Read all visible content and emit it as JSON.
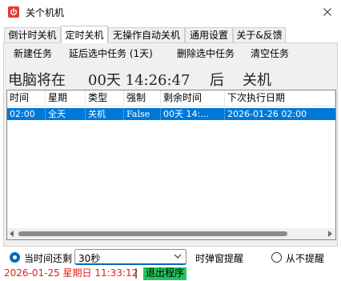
{
  "window": {
    "title": "关个机机",
    "icon": "power-red-square-icon",
    "close_icon": "close-icon"
  },
  "tabs": [
    {
      "label": "倒计时关机",
      "active": false
    },
    {
      "label": "定时关机",
      "active": true
    },
    {
      "label": "无操作自动关机",
      "active": false
    },
    {
      "label": "通用设置",
      "active": false
    },
    {
      "label": "关于&反馈",
      "active": false
    }
  ],
  "toolbar": {
    "new_task": "新建任务",
    "delay_task": "延后选中任务 (1天)",
    "delete_task": "删除选中任务",
    "clear_tasks": "清空任务"
  },
  "countdown": {
    "prefix": "电脑将在",
    "time": "00天 14:26:47",
    "after": "后",
    "action": "关机"
  },
  "table": {
    "columns": [
      "时间",
      "星期",
      "类型",
      "强制",
      "剩余时间",
      "下次执行日期"
    ],
    "rows": [
      {
        "time": "02:00",
        "weekday": "全天",
        "type": "关机",
        "force": "False",
        "remaining": "00天 14:...",
        "next": "2026-01-26 02:00",
        "selected": true
      }
    ]
  },
  "reminder": {
    "option_before": "当时间还剩",
    "option_before_checked": true,
    "interval_value": "30秒",
    "popup_label": "时弹窗提醒",
    "option_never": "从不提醒",
    "option_never_checked": false
  },
  "status": {
    "datetime": "2026-01-25 星期日 11:33:12",
    "separator": "|",
    "exit": "退出程序",
    "datetime_color": "#e0201b",
    "exit_bg": "#22c55e"
  },
  "colors": {
    "selection": "#0078d7",
    "accent": "#0067c0",
    "icon_red": "#e53935"
  }
}
